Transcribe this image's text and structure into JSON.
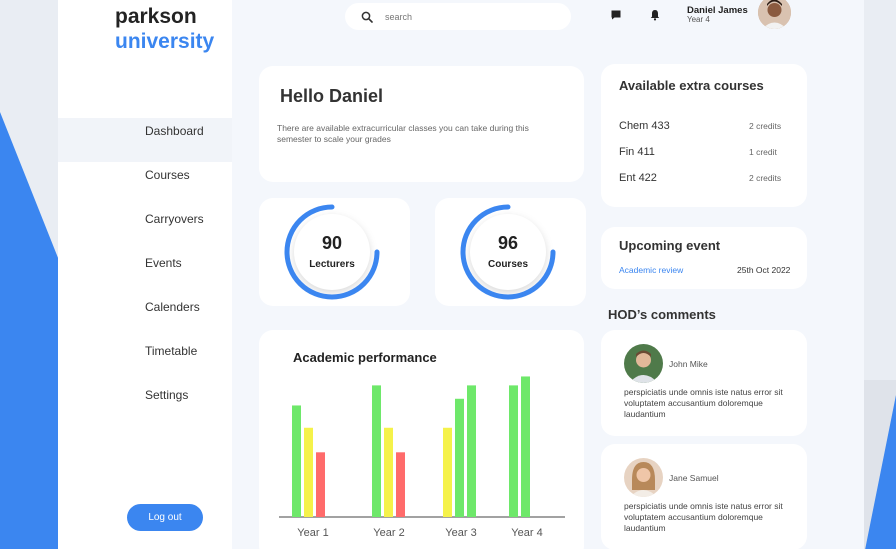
{
  "brand": {
    "line1": "parkson",
    "line2": "university",
    "accent": "#3b86f0"
  },
  "sidebar": {
    "items": [
      {
        "label": "Dashboard",
        "active": true
      },
      {
        "label": "Courses"
      },
      {
        "label": "Carryovers"
      },
      {
        "label": "Events"
      },
      {
        "label": "Calenders"
      },
      {
        "label": "Timetable"
      },
      {
        "label": "Settings"
      }
    ],
    "logout_label": "Log out"
  },
  "search": {
    "placeholder": "search",
    "icon": "search-icon"
  },
  "topbar": {
    "icons": [
      "chat-icon",
      "bell-icon"
    ]
  },
  "user": {
    "name": "Daniel James",
    "year": "Year 4"
  },
  "hello": {
    "title": "Hello Daniel",
    "text": "There are available extracurricular classes you can take during this semester to scale your grades"
  },
  "stats": [
    {
      "value": "90",
      "label": "Lecturers",
      "progress": 0.75
    },
    {
      "value": "96",
      "label": "Courses",
      "progress": 0.75
    }
  ],
  "performance": {
    "title": "Academic performance"
  },
  "extra_courses": {
    "title": "Available extra courses",
    "items": [
      {
        "code": "Chem 433",
        "credits": "2 credits"
      },
      {
        "code": "Fin 411",
        "credits": "1 credit"
      },
      {
        "code": "Ent 422",
        "credits": "2 credits"
      }
    ]
  },
  "event": {
    "title": "Upcoming event",
    "name": "Academic review",
    "date": "25th Oct 2022"
  },
  "hod": {
    "title": "HOD’s comments",
    "comments": [
      {
        "name": "John Mike",
        "text": "perspiciatis unde omnis iste natus error sit voluptatem accusantium doloremque laudantium"
      },
      {
        "name": "Jane Samuel",
        "text": "perspiciatis unde omnis iste natus error sit voluptatem accusantium doloremque laudantium"
      }
    ]
  },
  "chart_data": {
    "type": "bar",
    "title": "Academic performance",
    "categories": [
      "Year 1",
      "Year 2",
      "Year 3",
      "Year 4"
    ],
    "colors": [
      "#6ee86a",
      "#f5f24a",
      "#ff6b6b"
    ],
    "series_values": [
      [
        100,
        80,
        58
      ],
      [
        118,
        80,
        58
      ],
      [
        80,
        106,
        118
      ],
      [
        118,
        126
      ]
    ],
    "bar_colors": [
      [
        "#6ee86a",
        "#f5f24a",
        "#ff6b6b"
      ],
      [
        "#6ee86a",
        "#f5f24a",
        "#ff6b6b"
      ],
      [
        "#f5f24a",
        "#6ee86a",
        "#6ee86a"
      ],
      [
        "#6ee86a",
        "#6ee86a"
      ]
    ],
    "ylim": [
      0,
      130
    ],
    "grid": false
  }
}
